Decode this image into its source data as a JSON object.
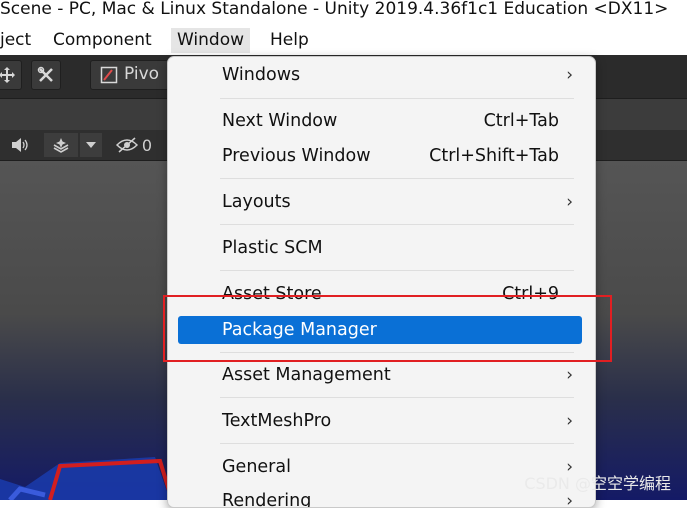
{
  "window": {
    "title": "Scene - PC, Mac & Linux Standalone - Unity 2019.4.36f1c1 Education <DX11>"
  },
  "menubar": {
    "items": [
      {
        "label": "ject"
      },
      {
        "label": "Component"
      },
      {
        "label": "Window"
      },
      {
        "label": "Help"
      }
    ]
  },
  "toolbar": {
    "pivot_label": "Pivo",
    "visibility_count": "0"
  },
  "window_menu": {
    "items": [
      {
        "label": "Windows",
        "shortcut": "",
        "submenu": true
      },
      {
        "label": "Next Window",
        "shortcut": "Ctrl+Tab",
        "submenu": false
      },
      {
        "label": "Previous Window",
        "shortcut": "Ctrl+Shift+Tab",
        "submenu": false
      },
      {
        "label": "Layouts",
        "shortcut": "",
        "submenu": true
      },
      {
        "label": "Plastic SCM",
        "shortcut": "",
        "submenu": false
      },
      {
        "label": "Asset Store",
        "shortcut": "Ctrl+9",
        "submenu": false
      },
      {
        "label": "Package Manager",
        "shortcut": "",
        "submenu": false,
        "highlighted": true
      },
      {
        "label": "Asset Management",
        "shortcut": "",
        "submenu": true
      },
      {
        "label": "TextMeshPro",
        "shortcut": "",
        "submenu": true
      },
      {
        "label": "General",
        "shortcut": "",
        "submenu": true
      },
      {
        "label": "Rendering",
        "shortcut": "",
        "submenu": true
      }
    ]
  },
  "icons": {
    "submenu_arrow": "›",
    "move_tool": "move-icon",
    "custom_tool": "tools-icon",
    "pivot": "pivot-icon",
    "audio": "speaker-icon",
    "effects": "layers-icon",
    "dropdown": "dropdown-icon",
    "visibility": "eye-off-icon"
  },
  "annotation": {
    "highlight_color": "#e11f22"
  },
  "accent": {
    "menu_highlight": "#0a70d6"
  },
  "watermark": {
    "text": "CSDN @空空学编程"
  }
}
